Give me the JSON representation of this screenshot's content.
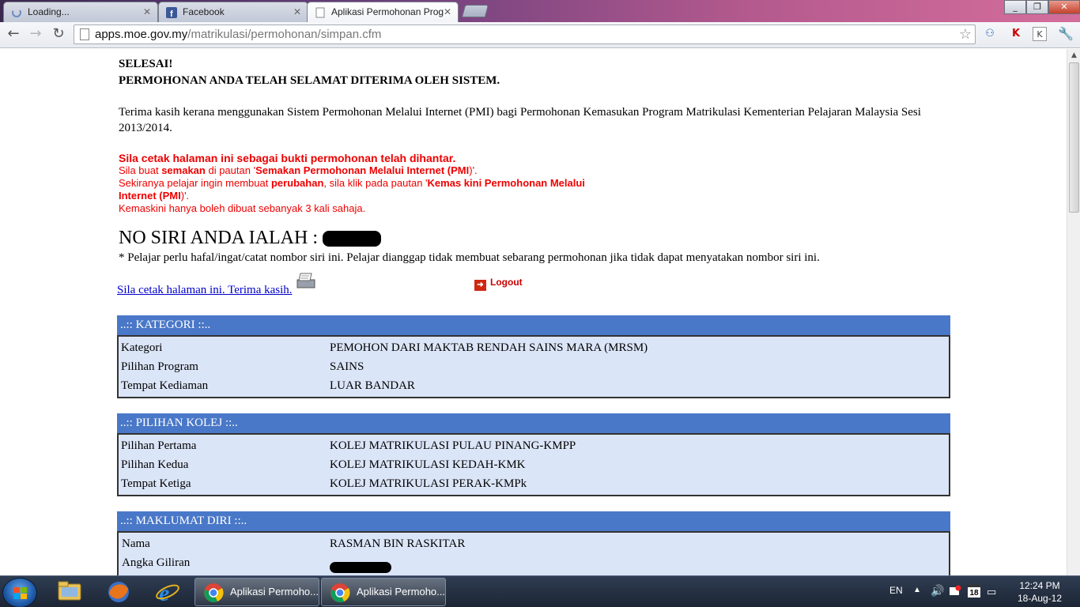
{
  "browser": {
    "tabs": [
      {
        "title": "Loading...",
        "active": false
      },
      {
        "title": "Facebook",
        "active": false
      },
      {
        "title": "Aplikasi Permohonan Prog",
        "active": true
      }
    ],
    "url_host": "apps.moe.gov.my",
    "url_path": "/matrikulasi/permohonan/simpan.cfm",
    "window_controls": [
      "minimize",
      "restore",
      "close"
    ]
  },
  "page": {
    "heading_line1": "SELESAI!",
    "heading_line2": "PERMOHONAN ANDA TELAH SELAMAT DITERIMA OLEH SISTEM.",
    "thanks_text": "Terima kasih kerana menggunakan Sistem Permohonan Melalui Internet (PMI) bagi Permohonan Kemasukan Program Matrikulasi Kementerian Pelajaran Malaysia Sesi 2013/2014.",
    "notice": {
      "line1": "Sila cetak halaman ini sebagai bukti permohonan telah dihantar.",
      "line2_a": "Sila buat ",
      "line2_b": "semakan",
      "line2_c": " di pautan '",
      "line2_d": "Semakan Permohonan Melalui Internet (PMI",
      "line2_e": ")'.",
      "line3_a": "Sekiranya pelajar ingin membuat ",
      "line3_b": "perubahan",
      "line3_c": ", sila klik pada pautan '",
      "line3_d": "Kemas kini Permohonan Melalui",
      "line3_e": "Internet (PMI",
      "line3_f": ")'.",
      "line4": "Kemaskini hanya boleh dibuat sebanyak 3 kali sahaja."
    },
    "serial_label": "NO SIRI ANDA IALAH :",
    "footnote": "* Pelajar perlu hafal/ingat/catat nombor siri ini. Pelajar dianggap tidak membuat sebarang permohonan jika tidak dapat menyatakan nombor siri ini.",
    "print_link": "Sila cetak halaman ini. Terima kasih.",
    "logout_label": "Logout",
    "sections": [
      {
        "title": "..:: KATEGORI ::..",
        "rows": [
          {
            "label": "Kategori",
            "value": "PEMOHON DARI MAKTAB RENDAH SAINS MARA (MRSM)"
          },
          {
            "label": "Pilihan Program",
            "value": "SAINS"
          },
          {
            "label": "Tempat Kediaman",
            "value": "LUAR BANDAR"
          }
        ]
      },
      {
        "title": "..:: PILIHAN KOLEJ ::..",
        "rows": [
          {
            "label": "Pilihan Pertama",
            "value": "KOLEJ MATRIKULASI PULAU PINANG-KMPP"
          },
          {
            "label": "Pilihan Kedua",
            "value": "KOLEJ MATRIKULASI KEDAH-KMK"
          },
          {
            "label": "Tempat Ketiga",
            "value": "KOLEJ MATRIKULASI PERAK-KMPk"
          }
        ]
      },
      {
        "title": "..:: MAKLUMAT DIRI ::..",
        "rows": [
          {
            "label": "Nama",
            "value": "RASMAN BIN RASKITAR"
          },
          {
            "label": "Angka Giliran",
            "value": ""
          }
        ]
      }
    ]
  },
  "taskbar": {
    "pinned": [
      "windows-explorer",
      "firefox",
      "internet-explorer"
    ],
    "windows": [
      {
        "title": "Aplikasi Permoho..."
      },
      {
        "title": "Aplikasi Permoho..."
      }
    ],
    "language": "EN",
    "tray_badge": "18",
    "time": "12:24 PM",
    "date": "18-Aug-12"
  },
  "colors": {
    "section_header": "#4a78c8",
    "section_body": "#dbe5f8",
    "notice_red": "#e00000",
    "link_blue": "#0000cc"
  }
}
